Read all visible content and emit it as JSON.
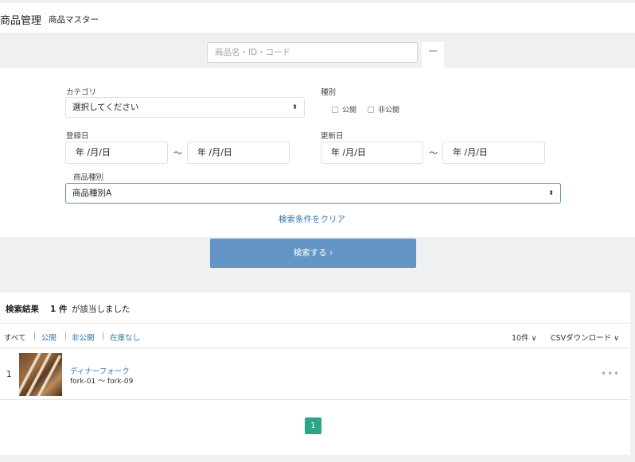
{
  "header": {
    "title": "商品管理",
    "subtitle": "商品マスター"
  },
  "search": {
    "placeholder": "商品名・ID・コード"
  },
  "filters": {
    "category_label": "カテゴリ",
    "category_value": "選択してください",
    "type_label": "種別",
    "type_options": [
      "公開",
      "非公開"
    ],
    "registered_label": "登録日",
    "updated_label": "更新日",
    "date_placeholder": "年 /月/日",
    "tilde": "〜",
    "product_type_label": "商品種別",
    "product_type_value": "商品種別A",
    "clear_label": "検索条件をクリア"
  },
  "search_button": {
    "label": "検索する ›"
  },
  "results": {
    "title": "検索結果",
    "count": "1 件",
    "suffix": "が該当しました",
    "tabs": {
      "all": "すべて",
      "public": "公開",
      "private": "非公開",
      "no_stock": "在庫なし",
      "sep": "|"
    },
    "per_page": "10件 ∨",
    "csv": "CSVダウンロード ∨",
    "items": [
      {
        "index": "1",
        "name": "ディナーフォーク",
        "code": "fork-01 ～ fork-09",
        "menu": "•••"
      }
    ],
    "pagination": {
      "current": "1"
    }
  }
}
